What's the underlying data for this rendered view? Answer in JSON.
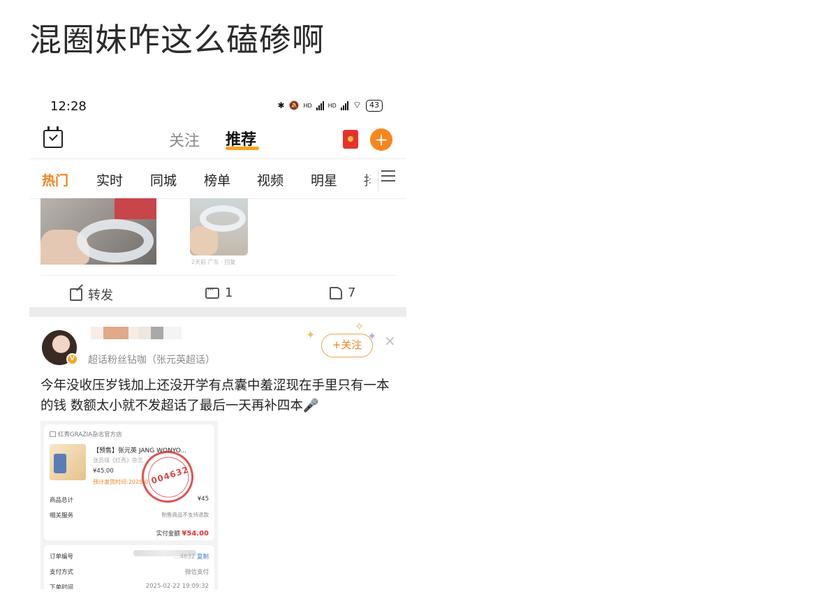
{
  "post_title": "混圈妹咋这么磕碜啊",
  "status_bar": {
    "time": "12:28",
    "hd1": "HD",
    "hd2": "HD",
    "battery": "43"
  },
  "header": {
    "tab_follow": "关注",
    "tab_recommend": "推荐"
  },
  "channels": [
    "热门",
    "实时",
    "同城",
    "榜单",
    "视频",
    "明星",
    "抖"
  ],
  "prev_post": {
    "image_caption": "2天前 广东 · 回复",
    "repost_label": "转发",
    "comment_count": "1",
    "like_count": "7"
  },
  "post": {
    "fan_label": "超话粉丝钻咖（张元英超话）",
    "follow_label": "+关注",
    "close_label": "×",
    "text": "今年没收压岁钱加上还没开学有点囊中羞涩现在手里只有一本的钱 数额太小就不发超话了最后一天再补四本🎤"
  },
  "order": {
    "shop_name": "红秀GRAZIA杂志官方店",
    "product_title": "【预售】张元英 JANG WONYO...",
    "product_sub": "张员瑛《红秀》杂志",
    "price": "¥45.00",
    "ship_time": "预计发货时间:2025-0",
    "stamp_text": "004632",
    "rows": [
      {
        "label": "商品总计",
        "value": "¥45"
      },
      {
        "label": "相关服务",
        "value": "制售商品不支持退款"
      }
    ],
    "paid_label": "实付金额",
    "paid_value": "¥54.00",
    "order_no_label": "订单编号",
    "order_no_tail": "…4632",
    "copy_label": "复制",
    "pay_method_label": "支付方式",
    "pay_method_value": "微信支付",
    "order_time_label": "下单时间",
    "order_time_value": "2025-02-22 19:09:32"
  },
  "colors": {
    "accent": "#f0821e",
    "tab_underline": "#f7a51c",
    "red": "#e6332a"
  }
}
